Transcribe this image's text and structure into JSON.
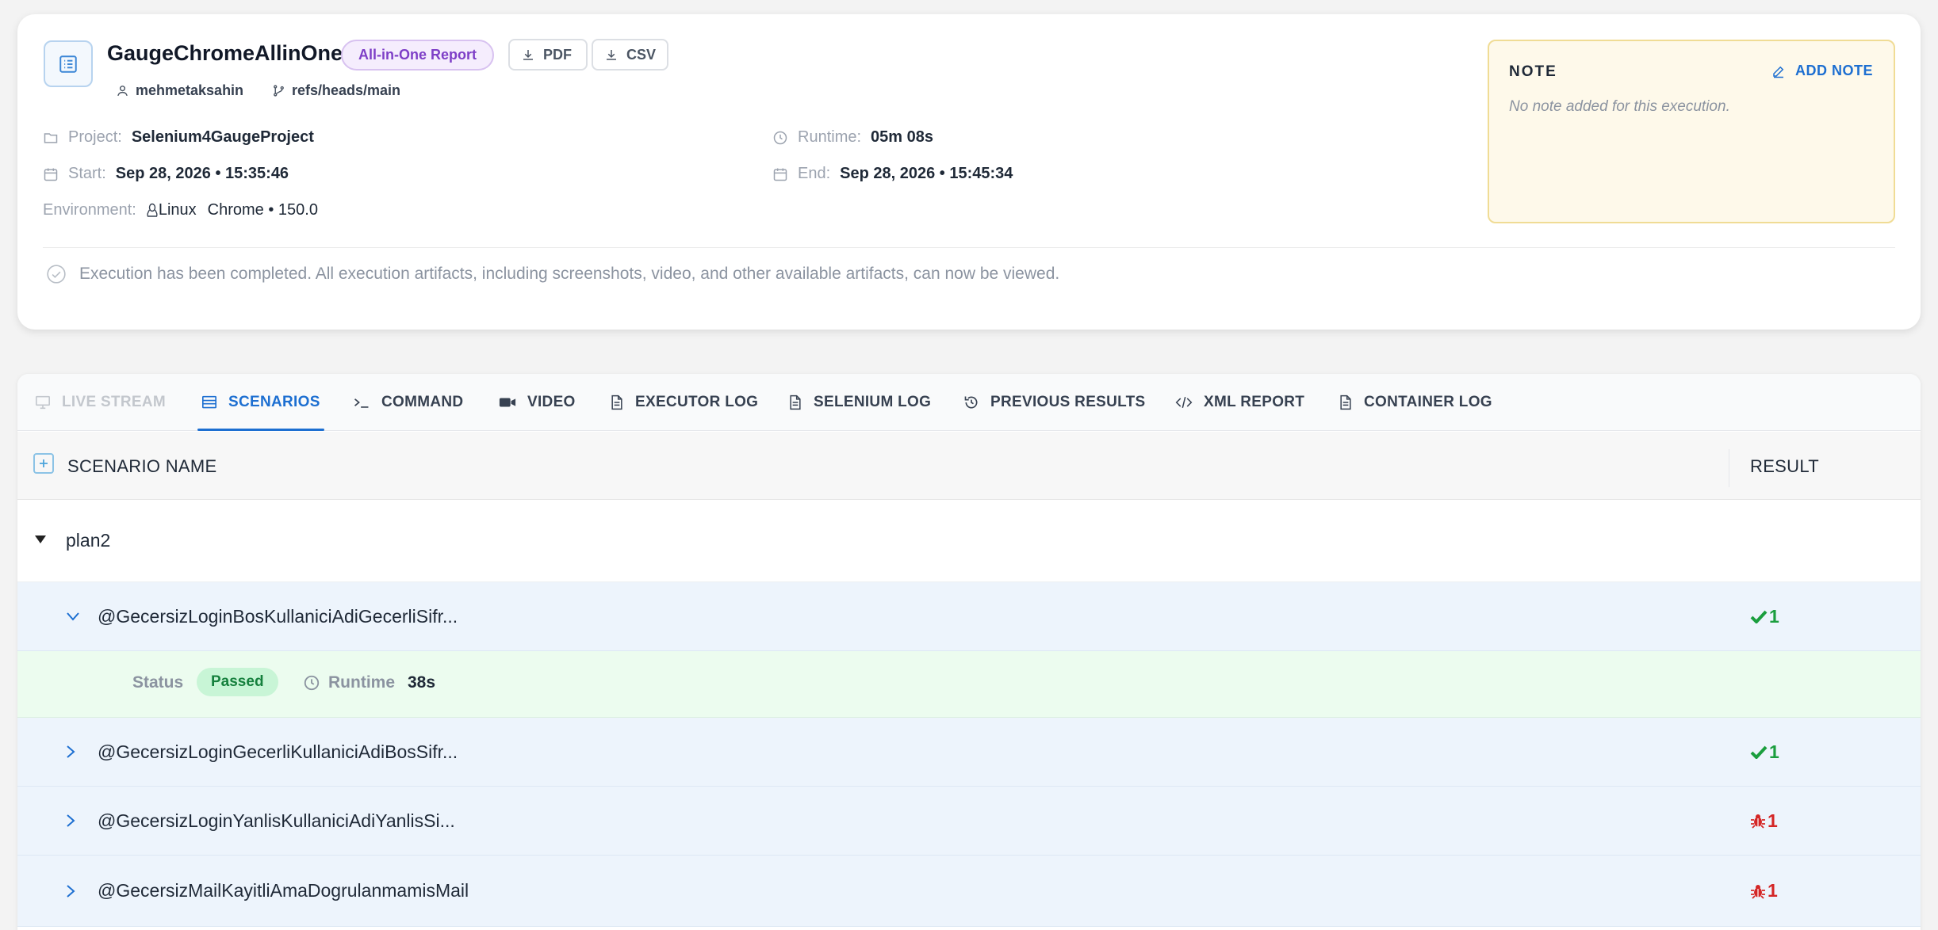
{
  "execution": {
    "title": "GaugeChromeAllinOne",
    "report_badge": "All-in-One Report",
    "download_pdf": "PDF",
    "download_csv": "CSV",
    "user": "mehmetaksahin",
    "branch": "refs/heads/main"
  },
  "info": {
    "project_label": "Project:",
    "project_value": "Selenium4GaugeProject",
    "runtime_label": "Runtime:",
    "runtime_value": "05m 08s",
    "start_label": "Start:",
    "start_value": "Sep 28, 2026 • 15:35:46",
    "end_label": "End:",
    "end_value": "Sep 28, 2026 • 15:45:34",
    "environment_label": "Environment:",
    "environment_os": "Linux",
    "environment_browser": "Chrome • 150.0"
  },
  "status_message": "Execution has been completed. All execution artifacts, including screenshots, video, and other available artifacts, can now be viewed.",
  "note": {
    "title": "NOTE",
    "add_label": "ADD NOTE",
    "empty_text": "No note added for this execution."
  },
  "tabs": [
    {
      "label": "LIVE STREAM",
      "icon": "monitor-icon",
      "state": "disabled"
    },
    {
      "label": "SCENARIOS",
      "icon": "table-icon",
      "state": "active"
    },
    {
      "label": "COMMAND",
      "icon": "terminal-icon",
      "state": "normal"
    },
    {
      "label": "VIDEO",
      "icon": "video-camera-icon",
      "state": "normal"
    },
    {
      "label": "EXECUTOR LOG",
      "icon": "file-icon",
      "state": "normal"
    },
    {
      "label": "SELENIUM LOG",
      "icon": "file-icon",
      "state": "normal"
    },
    {
      "label": "PREVIOUS RESULTS",
      "icon": "history-icon",
      "state": "normal"
    },
    {
      "label": "XML REPORT",
      "icon": "code-icon",
      "state": "normal"
    },
    {
      "label": "CONTAINER LOG",
      "icon": "file-icon",
      "state": "normal"
    }
  ],
  "table": {
    "col_name": "SCENARIO NAME",
    "col_result": "RESULT",
    "plan_name": "plan2",
    "scenarios": [
      {
        "name": "@GecersizLoginBosKullaniciAdiGecerliSifr...",
        "result": "pass",
        "count": "1",
        "expanded": true
      },
      {
        "name": "@GecersizLoginGecerliKullaniciAdiBosSifr...",
        "result": "pass",
        "count": "1",
        "expanded": false
      },
      {
        "name": "@GecersizLoginYanlisKullaniciAdiYanlisSi...",
        "result": "fail",
        "count": "1",
        "expanded": false
      },
      {
        "name": "@GecersizMailKayitliAmaDogrulanmamisMail",
        "result": "fail",
        "count": "1",
        "expanded": false
      }
    ],
    "detail": {
      "status_label": "Status",
      "status_value": "Passed",
      "runtime_label": "Runtime",
      "runtime_value": "38s"
    }
  },
  "colors": {
    "accent": "#1d6fd1",
    "pass": "#1b9e3e",
    "fail": "#d42626",
    "badge_purple": "#7e3fc7"
  }
}
